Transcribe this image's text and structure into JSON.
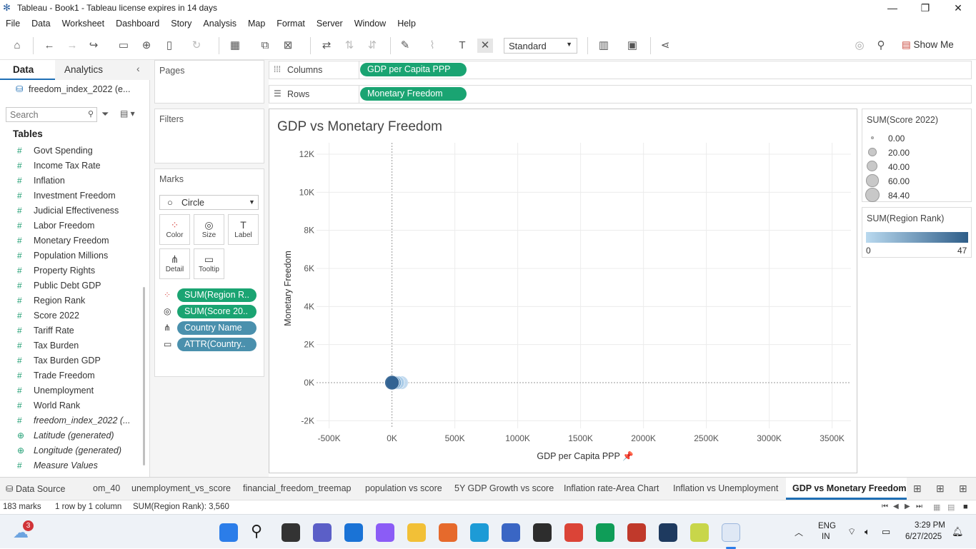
{
  "window": {
    "title": "Tableau - Book1 - Tableau license expires in 14 days"
  },
  "menu": [
    "File",
    "Data",
    "Worksheet",
    "Dashboard",
    "Story",
    "Analysis",
    "Map",
    "Format",
    "Server",
    "Window",
    "Help"
  ],
  "toolbar": {
    "mark_size_select": "Standard",
    "show_me": "Show Me"
  },
  "left_pane": {
    "tab_data": "Data",
    "tab_analytics": "Analytics",
    "datasource": "freedom_index_2022 (e...",
    "search_placeholder": "Search",
    "tables_header": "Tables",
    "fields": [
      {
        "name": "Govt Spending",
        "type": "measure"
      },
      {
        "name": "Income Tax Rate",
        "type": "measure"
      },
      {
        "name": "Inflation",
        "type": "measure"
      },
      {
        "name": "Investment Freedom",
        "type": "measure"
      },
      {
        "name": "Judicial Effectiveness",
        "type": "measure"
      },
      {
        "name": "Labor Freedom",
        "type": "measure"
      },
      {
        "name": "Monetary Freedom",
        "type": "measure"
      },
      {
        "name": "Population Millions",
        "type": "measure"
      },
      {
        "name": "Property Rights",
        "type": "measure"
      },
      {
        "name": "Public Debt GDP",
        "type": "measure"
      },
      {
        "name": "Region Rank",
        "type": "measure"
      },
      {
        "name": "Score 2022",
        "type": "measure"
      },
      {
        "name": "Tariff Rate",
        "type": "measure"
      },
      {
        "name": "Tax Burden",
        "type": "measure"
      },
      {
        "name": "Tax Burden GDP",
        "type": "measure"
      },
      {
        "name": "Trade Freedom",
        "type": "measure"
      },
      {
        "name": "Unemployment",
        "type": "measure"
      },
      {
        "name": "World Rank",
        "type": "measure"
      },
      {
        "name": "freedom_index_2022 (...",
        "type": "count"
      },
      {
        "name": "Latitude (generated)",
        "type": "geo"
      },
      {
        "name": "Longitude (generated)",
        "type": "geo"
      },
      {
        "name": "Measure Values",
        "type": "measure"
      }
    ]
  },
  "cards": {
    "pages": "Pages",
    "filters": "Filters",
    "marks": "Marks",
    "mark_type": "Circle",
    "mark_buttons": [
      "Color",
      "Size",
      "Label",
      "Detail",
      "Tooltip"
    ],
    "mark_pills": [
      "SUM(Region R..",
      "SUM(Score 20..",
      "Country Name",
      "ATTR(Country.."
    ]
  },
  "shelves": {
    "columns_label": "Columns",
    "columns_pill": "GDP per Capita PPP",
    "rows_label": "Rows",
    "rows_pill": "Monetary Freedom"
  },
  "chart_data": {
    "type": "scatter",
    "title": "GDP vs Monetary Freedom",
    "xlabel": "GDP per Capita PPP",
    "ylabel": "Monetary Freedom",
    "xlim": [
      -600000,
      3650000
    ],
    "ylim": [
      -2400,
      12600
    ],
    "x_ticks": [
      -500000,
      0,
      500000,
      1000000,
      1500000,
      2000000,
      2500000,
      3000000,
      3500000
    ],
    "x_tick_labels": [
      "-500K",
      "0K",
      "500K",
      "1000K",
      "1500K",
      "2000K",
      "2500K",
      "3000K",
      "3500K"
    ],
    "y_ticks": [
      -2000,
      0,
      2000,
      4000,
      6000,
      8000,
      10000,
      12000
    ],
    "y_tick_labels": [
      "-2K",
      "0K",
      "2K",
      "4K",
      "6K",
      "8K",
      "10K",
      "12K"
    ],
    "grid": true,
    "points": [
      {
        "x": 0,
        "y": 0,
        "size": 84.4,
        "color": "#2f5f8f"
      },
      {
        "x": 20000,
        "y": 0,
        "size": 70,
        "color": "#7aa8d0"
      },
      {
        "x": 45000,
        "y": 0,
        "size": 70,
        "color": "#a9cbe8"
      },
      {
        "x": 75000,
        "y": 0,
        "size": 70,
        "color": "#bdd7ee"
      },
      {
        "x": 5000,
        "y": 0,
        "size": 60,
        "color": "#4a7eb0"
      }
    ]
  },
  "legend_size": {
    "title": "SUM(Score 2022)",
    "items": [
      "0.00",
      "20.00",
      "40.00",
      "60.00",
      "84.40"
    ]
  },
  "legend_color": {
    "title": "SUM(Region Rank)",
    "min": "0",
    "max": "47",
    "color_low": "#b9d9ef",
    "color_high": "#2e5d88"
  },
  "sheet_tabs": {
    "datasource": "Data Source",
    "tabs": [
      "om_40",
      "unemployment_vs_score",
      "financial_freedom_treemap",
      "population vs score",
      "5Y GDP Growth vs score",
      "Inflation rate-Area Chart",
      "Inflation vs Unemployment",
      "GDP vs Monetary Freedom"
    ]
  },
  "status": {
    "marks": "183 marks",
    "rows_cols": "1 row by 1 column",
    "sum": "SUM(Region Rank): 3,560"
  },
  "taskbar": {
    "notification_count": "3",
    "lang1": "ENG",
    "lang2": "IN",
    "time": "3:29 PM",
    "date": "6/27/2025"
  }
}
